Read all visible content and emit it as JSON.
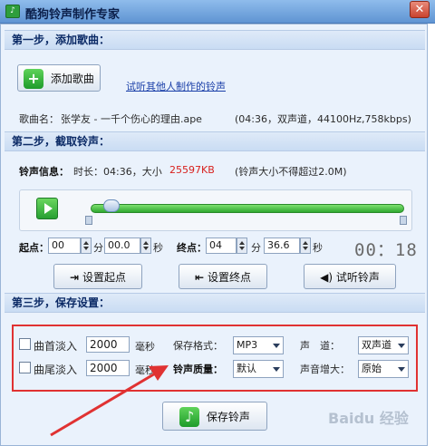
{
  "window": {
    "title": "酷狗铃声制作专家"
  },
  "step1": {
    "header": "第一步，添加歌曲：",
    "add_button": "添加歌曲",
    "listen_link": "试听其他人制作的铃声",
    "song_label": "歌曲名：",
    "song_name": "张学友 - 一千个伤心的理由.ape",
    "song_info": "(04:36，双声道，44100Hz,758kbps)"
  },
  "step2": {
    "header": "第二步，截取铃声：",
    "info_label": "铃声信息：",
    "info_text": "时长：04:36，大小",
    "size": "25597KB",
    "size_note": "(铃声大小不得超过2.0M)",
    "start_label": "起点：",
    "start_min": "00",
    "start_sec": "00.0",
    "end_label": "终点：",
    "end_min": "04",
    "end_sec": "36.6",
    "unit_min": "分",
    "unit_sec": "秒",
    "duration_display": "00：18",
    "set_start_button": "设置起点",
    "set_end_button": "设置终点",
    "preview_button": "试听铃声"
  },
  "step3": {
    "header": "第三步，保存设置：",
    "fade_in_label": "曲首淡入",
    "fade_in_value": "2000",
    "fade_out_label": "曲尾淡入",
    "fade_out_value": "2000",
    "ms_unit": "毫秒",
    "format_label": "保存格式：",
    "format_value": "MP3",
    "quality_label": "铃声质量：",
    "quality_value": "默认",
    "channel_label": "声　道：",
    "channel_value": "双声道",
    "volume_label": "声音增大：",
    "volume_value": "原始",
    "save_button": "保存铃声"
  },
  "watermark": "Baidu 经验",
  "colors": {
    "accent_red": "#e03232",
    "size_red": "#d8201e",
    "green": "#2fa930"
  }
}
